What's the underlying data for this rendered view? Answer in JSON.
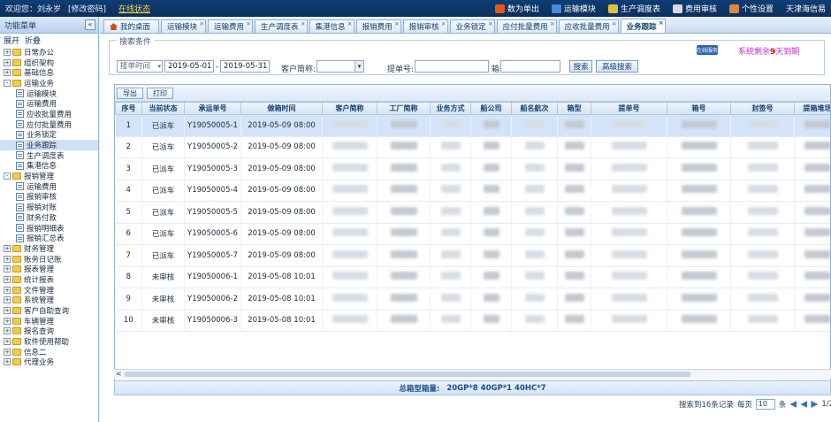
{
  "topbar": {
    "welcome": "欢迎您：刘永岁",
    "change_password": "[修改密码]",
    "online": "在线状态",
    "right_items": [
      {
        "label": "数为单出",
        "icon": "home-icon",
        "color": "#e05a1e"
      },
      {
        "label": "运输模块",
        "icon": "truck-icon",
        "color": "#4a8ad8"
      },
      {
        "label": "生产调度表",
        "icon": "folder-icon",
        "color": "#e0c040"
      },
      {
        "label": "费用审核",
        "icon": "doc-icon",
        "color": "#d8d8d8"
      },
      {
        "label": "个性设置",
        "icon": "user-icon",
        "color": "#d88a3a"
      },
      {
        "label": "天津海信易",
        "icon": "",
        "color": ""
      }
    ]
  },
  "sidebar": {
    "title": "功能菜单",
    "collapse": "«",
    "expand_label": "展开",
    "fold_label": "折叠",
    "items": [
      {
        "label": "日常办公",
        "type": "folder",
        "pm": "+",
        "indent": 0
      },
      {
        "label": "组织架构",
        "type": "folder",
        "pm": "+",
        "indent": 0
      },
      {
        "label": "基础信息",
        "type": "folder",
        "pm": "+",
        "indent": 0
      },
      {
        "label": "运输业务",
        "type": "folder",
        "pm": "-",
        "indent": 0
      },
      {
        "label": "运输模块",
        "type": "leaf",
        "indent": 1
      },
      {
        "label": "运输费用",
        "type": "leaf",
        "indent": 1
      },
      {
        "label": "应收批量费用",
        "type": "leaf",
        "indent": 1
      },
      {
        "label": "应付批量费用",
        "type": "leaf",
        "indent": 1
      },
      {
        "label": "业务锁定",
        "type": "leaf",
        "indent": 1
      },
      {
        "label": "业务跟踪",
        "type": "leaf",
        "indent": 1,
        "selected": true
      },
      {
        "label": "生产调度表",
        "type": "leaf",
        "indent": 1
      },
      {
        "label": "集港信息",
        "type": "leaf",
        "indent": 1
      },
      {
        "label": "报销管理",
        "type": "folder",
        "pm": "-",
        "indent": 0
      },
      {
        "label": "运输费用",
        "type": "leaf",
        "indent": 1
      },
      {
        "label": "报销审核",
        "type": "leaf",
        "indent": 1
      },
      {
        "label": "报销对账",
        "type": "leaf",
        "indent": 1
      },
      {
        "label": "财务付款",
        "type": "leaf",
        "indent": 1
      },
      {
        "label": "报销明细表",
        "type": "leaf",
        "indent": 1
      },
      {
        "label": "报销汇总表",
        "type": "leaf",
        "indent": 1
      },
      {
        "label": "财务管理",
        "type": "folder",
        "pm": "+",
        "indent": 0
      },
      {
        "label": "账务日记账",
        "type": "folder",
        "pm": "+",
        "indent": 0
      },
      {
        "label": "报表管理",
        "type": "folder",
        "pm": "+",
        "indent": 0
      },
      {
        "label": "统计报表",
        "type": "folder",
        "pm": "+",
        "indent": 0
      },
      {
        "label": "文件管理",
        "type": "folder",
        "pm": "+",
        "indent": 0
      },
      {
        "label": "系统管理",
        "type": "folder",
        "pm": "+",
        "indent": 0
      },
      {
        "label": "客户自助查询",
        "type": "folder",
        "pm": "+",
        "indent": 0
      },
      {
        "label": "车辆管理",
        "type": "folder",
        "pm": "+",
        "indent": 0
      },
      {
        "label": "报名查询",
        "type": "folder",
        "pm": "+",
        "indent": 0
      },
      {
        "label": "软件使用帮助",
        "type": "folder",
        "pm": "+",
        "indent": 0
      },
      {
        "label": "信息二",
        "type": "folder",
        "pm": "+",
        "indent": 0
      },
      {
        "label": "代理业务",
        "type": "folder",
        "pm": "+",
        "indent": 0
      }
    ]
  },
  "tabs": [
    {
      "label": "我的桌面",
      "home": true
    },
    {
      "label": "运输模块"
    },
    {
      "label": "运输费用"
    },
    {
      "label": "生产调度表"
    },
    {
      "label": "集港信息"
    },
    {
      "label": "报销费用"
    },
    {
      "label": "报销审核"
    },
    {
      "label": "业务锁定"
    },
    {
      "label": "应付批量费用"
    },
    {
      "label": "应收批量费用"
    },
    {
      "label": "业务跟踪",
      "active": true
    }
  ],
  "search": {
    "legend": "搜索条件",
    "date_type": "接单时间",
    "date_from": "2019-05-01",
    "date_sep": "-",
    "date_to": "2019-05-31",
    "customer_label": "客户简称:",
    "bill_label": "提单号:",
    "box_label": "箱号:",
    "search_btn": "搜索",
    "advanced_btn": "高级搜索",
    "help_label": "在线服务",
    "system_note_prefix": "系统剩余",
    "system_note_days": "9",
    "system_note_suffix": "天到期"
  },
  "grid": {
    "export_btn": "导出",
    "print_btn": "打印",
    "columns": [
      "序号",
      "当前状态",
      "承运单号",
      "做箱时间",
      "客户简称",
      "工厂简称",
      "业务方式",
      "船公司",
      "船名航次",
      "箱型",
      "提单号",
      "箱号",
      "封签号",
      "提箱堆场"
    ],
    "rows": [
      {
        "no": "1",
        "status": "已派车",
        "order": "Y19050005-1",
        "time": "2019-05-09 08:00"
      },
      {
        "no": "2",
        "status": "已派车",
        "order": "Y19050005-2",
        "time": "2019-05-09 08:00"
      },
      {
        "no": "3",
        "status": "已派车",
        "order": "Y19050005-3",
        "time": "2019-05-09 08:00"
      },
      {
        "no": "4",
        "status": "已派车",
        "order": "Y19050005-4",
        "time": "2019-05-09 08:00"
      },
      {
        "no": "5",
        "status": "已派车",
        "order": "Y19050005-5",
        "time": "2019-05-09 08:00"
      },
      {
        "no": "6",
        "status": "已派车",
        "order": "Y19050005-6",
        "time": "2019-05-09 08:00"
      },
      {
        "no": "7",
        "status": "已派车",
        "order": "Y19050005-7",
        "time": "2019-05-09 08:00"
      },
      {
        "no": "8",
        "status": "未审核",
        "order": "Y19050006-1",
        "time": "2019-05-08 10:01"
      },
      {
        "no": "9",
        "status": "未审核",
        "order": "Y19050006-2",
        "time": "2019-05-08 10:01"
      },
      {
        "no": "10",
        "status": "未审核",
        "order": "Y19050006-3",
        "time": "2019-05-08 10:01"
      }
    ],
    "scroll_left": "<",
    "footer_label": "总箱型箱量:",
    "footer_value": "20GP*8 40GP*1 40HC*7"
  },
  "pager": {
    "total_text": "搜索到16条记录",
    "per_page_label": "每页",
    "per_page_value": "10",
    "per_page_suffix": "条",
    "page_text": "1/2"
  }
}
